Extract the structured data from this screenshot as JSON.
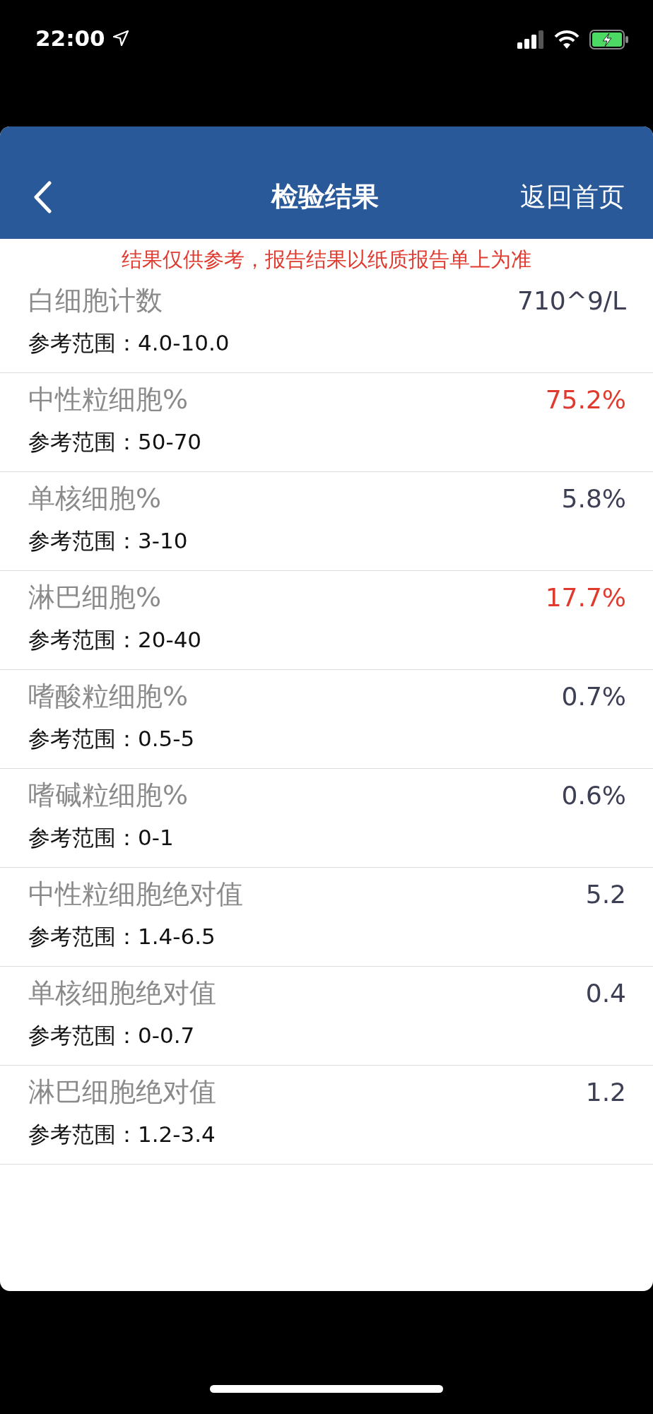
{
  "status_bar": {
    "time": "22:00"
  },
  "header": {
    "title": "检验结果",
    "home_link": "返回首页"
  },
  "notice": "结果仅供参考，报告结果以纸质报告单上为准",
  "results": [
    {
      "name": "白细胞计数",
      "value": "710^9/L",
      "abnormal": false,
      "range": "参考范围：4.0-10.0"
    },
    {
      "name": "中性粒细胞%",
      "value": "75.2%",
      "abnormal": true,
      "range": "参考范围：50-70"
    },
    {
      "name": "单核细胞%",
      "value": "5.8%",
      "abnormal": false,
      "range": "参考范围：3-10"
    },
    {
      "name": "淋巴细胞%",
      "value": "17.7%",
      "abnormal": true,
      "range": "参考范围：20-40"
    },
    {
      "name": "嗜酸粒细胞%",
      "value": "0.7%",
      "abnormal": false,
      "range": "参考范围：0.5-5"
    },
    {
      "name": "嗜碱粒细胞%",
      "value": "0.6%",
      "abnormal": false,
      "range": "参考范围：0-1"
    },
    {
      "name": "中性粒细胞绝对值",
      "value": "5.2",
      "abnormal": false,
      "range": "参考范围：1.4-6.5"
    },
    {
      "name": "单核细胞绝对值",
      "value": "0.4",
      "abnormal": false,
      "range": "参考范围：0-0.7"
    },
    {
      "name": "淋巴细胞绝对值",
      "value": "1.2",
      "abnormal": false,
      "range": "参考范围：1.2-3.4"
    }
  ]
}
